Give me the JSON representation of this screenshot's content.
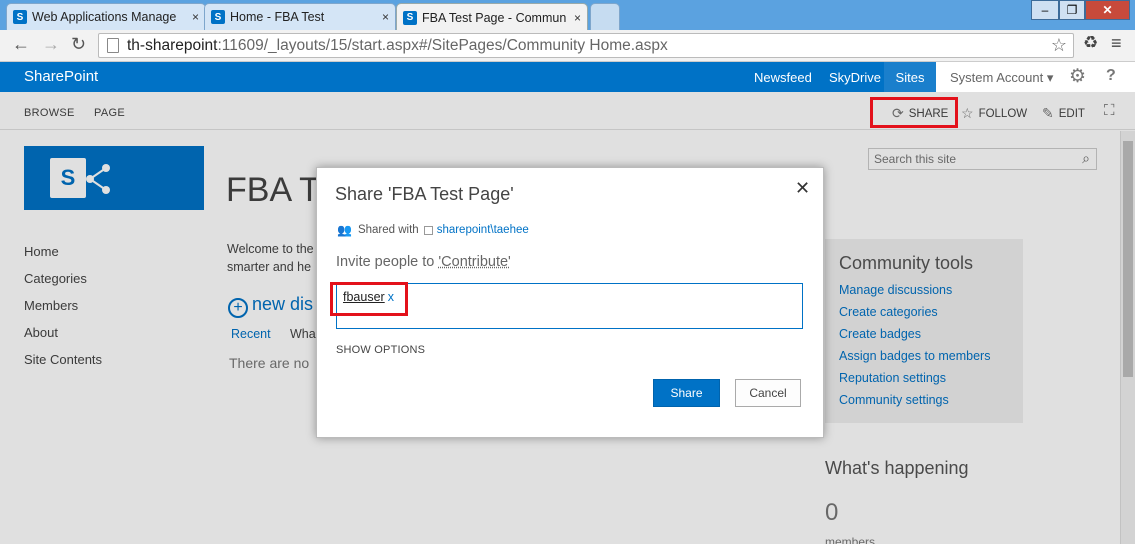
{
  "browser": {
    "tabs": [
      {
        "title": "Web Applications Manage",
        "favicon": "S",
        "active": false
      },
      {
        "title": "Home - FBA Test",
        "favicon": "S",
        "active": false
      },
      {
        "title": "FBA Test Page - Commun",
        "favicon": "S",
        "active": true
      }
    ],
    "url_host": "th-sharepoint",
    "url_path": ":11609/_layouts/15/start.aspx#/SitePages/Community Home.aspx",
    "window_controls": {
      "minimize": "–",
      "restore": "❐",
      "close": "✕"
    }
  },
  "suitebar": {
    "brand": "SharePoint",
    "links": {
      "newsfeed": "Newsfeed",
      "skydrive": "SkyDrive",
      "sites": "Sites"
    },
    "account": "System Account ▾",
    "brand_color": "#0072c6"
  },
  "ribbon": {
    "tabs": {
      "browse": "BROWSE",
      "page": "PAGE"
    },
    "actions": {
      "share": "SHARE",
      "follow": "FOLLOW",
      "edit": "EDIT"
    }
  },
  "site": {
    "title": "FBA Te",
    "search_placeholder": "Search this site",
    "quick_launch": [
      "Home",
      "Categories",
      "Members",
      "About",
      "Site Contents"
    ],
    "welcome_line1": "Welcome to the",
    "welcome_line2": "smarter and he",
    "new_discussion": "new dis",
    "filter_recent": "Recent",
    "filter_what": "Wha",
    "no_discussions": "There are no"
  },
  "community_tools": {
    "heading": "Community tools",
    "links": [
      "Manage discussions",
      "Create categories",
      "Create badges",
      "Assign badges to members",
      "Reputation settings",
      "Community settings"
    ]
  },
  "whats_happening": {
    "heading": "What's happening",
    "member_count": "0",
    "member_label": "members"
  },
  "dialog": {
    "title": "Share 'FBA Test Page'",
    "close": "✕",
    "shared_with_label": "Shared with",
    "shared_with_user": "sharepoint\\taehee",
    "invite_prefix": "Invite people to ",
    "invite_permission": "'Contribute'",
    "invitee": "fbauser",
    "invitee_remove": "x",
    "show_options": "SHOW OPTIONS",
    "share_button": "Share",
    "cancel_button": "Cancel"
  },
  "highlight_color": "#e3111b"
}
